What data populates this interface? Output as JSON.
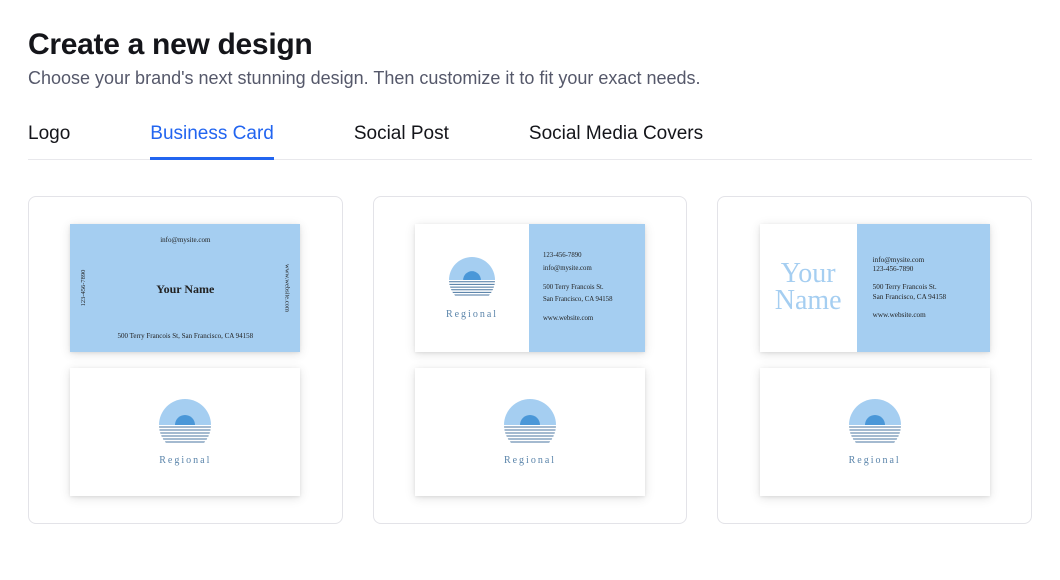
{
  "header": {
    "title": "Create a new design",
    "subtitle": "Choose your brand's next stunning design. Then customize it to fit your exact needs."
  },
  "tabs": [
    {
      "label": "Logo",
      "active": false
    },
    {
      "label": "Business Card",
      "active": true
    },
    {
      "label": "Social Post",
      "active": false
    },
    {
      "label": "Social Media Covers",
      "active": false
    }
  ],
  "brand_name": "Regional",
  "contact": {
    "email": "info@mysite.com",
    "phone": "123-456-7890",
    "website": "www.website.com",
    "address_line1": "500 Terry Francois St.",
    "address_line2": "San Francisco, CA 94158",
    "address_full": "500 Terry Francois St, San Francisco, CA 94158"
  },
  "your_name": "Your Name",
  "your_name_split": {
    "line1": "Your",
    "line2": "Name"
  },
  "colors": {
    "accent": "#2265f0",
    "card_blue": "#a5cef1",
    "brand_text": "#5a84aa"
  }
}
